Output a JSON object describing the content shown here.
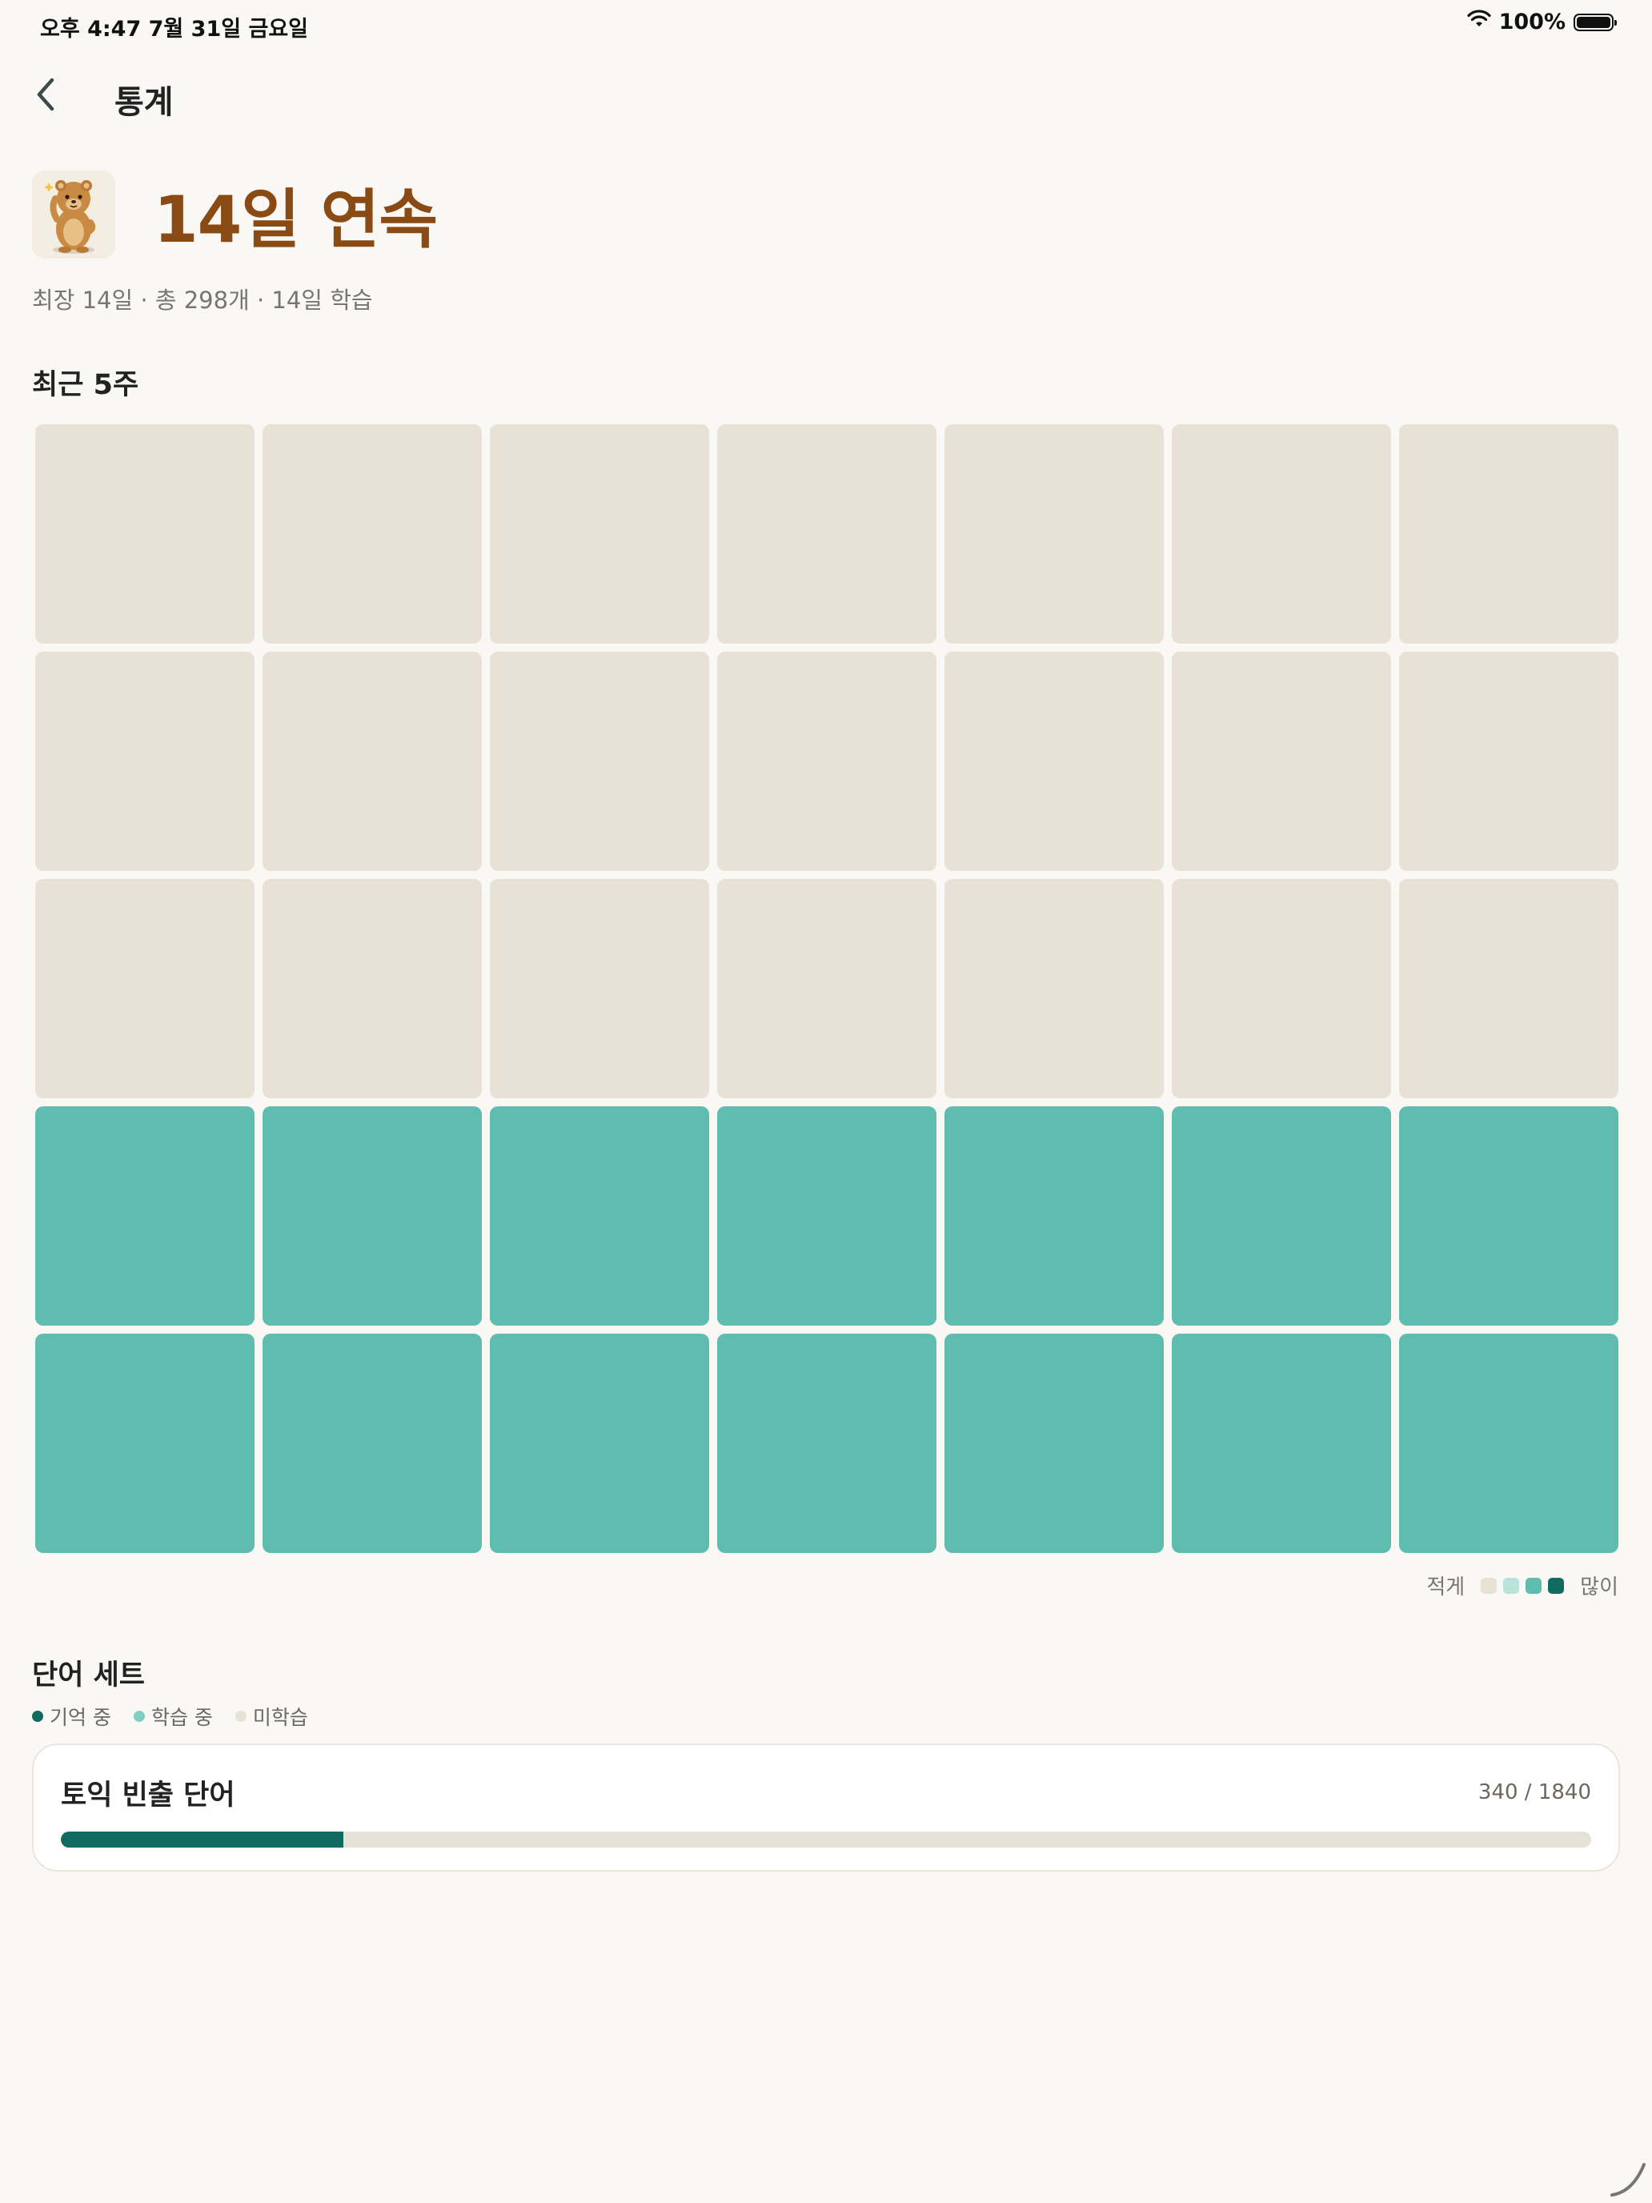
{
  "status_bar": {
    "time_date": "오후 4:47   7월 31일 금요일",
    "battery": "100%",
    "wifi_icon": "wifi-icon",
    "battery_icon": "battery-icon"
  },
  "nav": {
    "back_icon": "chevron-left-icon",
    "title": "통계"
  },
  "streak": {
    "mascot_icon": "quokka-mascot-icon",
    "title": "14일 연속",
    "subtitle": "최장 14일 · 총 298개 · 14일 학습"
  },
  "heatmap": {
    "title": "최근 5주",
    "columns": 7,
    "levels": [
      [
        0,
        0,
        0,
        0,
        0,
        0,
        0
      ],
      [
        0,
        0,
        0,
        0,
        0,
        0,
        0
      ],
      [
        0,
        0,
        0,
        0,
        0,
        0,
        0
      ],
      [
        2,
        2,
        2,
        2,
        2,
        2,
        2
      ],
      [
        2,
        2,
        2,
        2,
        2,
        2,
        2
      ]
    ],
    "level_colors": [
      "#e7e1d6",
      "#b8e3da",
      "#5fbdb0",
      "#116b61"
    ],
    "legend_less": "적게",
    "legend_more": "많이"
  },
  "sets": {
    "title": "단어 세트",
    "key": [
      {
        "label": "기억 중",
        "color": "#116b61"
      },
      {
        "label": "학습 중",
        "color": "#7fcfc2"
      },
      {
        "label": "미학습",
        "color": "#e7e1d6"
      }
    ],
    "items": [
      {
        "name": "토익 빈출 단어",
        "count": "340 / 1840",
        "memorized": 340,
        "total": 1840
      }
    ]
  },
  "colors": {
    "accent": "#116b61",
    "background": "#faf8f4",
    "streak_text": "#8a4a14"
  }
}
